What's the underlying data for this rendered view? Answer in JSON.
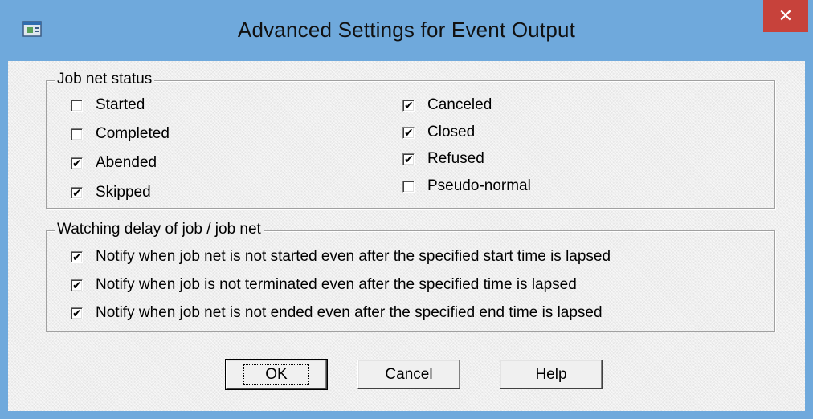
{
  "window": {
    "title": "Advanced Settings for Event Output",
    "close_label": "✕",
    "app_icon": "window-settings-icon"
  },
  "job_net_status": {
    "title": "Job net status",
    "left": [
      {
        "label": "Started",
        "checked": false
      },
      {
        "label": "Completed",
        "checked": false
      },
      {
        "label": "Abended",
        "checked": true
      },
      {
        "label": "Skipped",
        "checked": true
      }
    ],
    "right": [
      {
        "label": "Canceled",
        "checked": true
      },
      {
        "label": "Closed",
        "checked": true
      },
      {
        "label": "Refused",
        "checked": true
      },
      {
        "label": "Pseudo-normal",
        "checked": false
      }
    ]
  },
  "watching_delay": {
    "title": "Watching delay of job / job net",
    "items": [
      {
        "label": "Notify when job net is not started even after the specified start time is lapsed",
        "checked": true
      },
      {
        "label": "Notify when job is not terminated even after the specified time is lapsed",
        "checked": true
      },
      {
        "label": "Notify when job net is not ended even after the specified end time is lapsed",
        "checked": true
      }
    ]
  },
  "buttons": {
    "ok": "OK",
    "cancel": "Cancel",
    "help": "Help"
  },
  "colors": {
    "titlebar": "#6fa9dc",
    "close": "#c7423b",
    "dialog_bg": "#efefef"
  }
}
